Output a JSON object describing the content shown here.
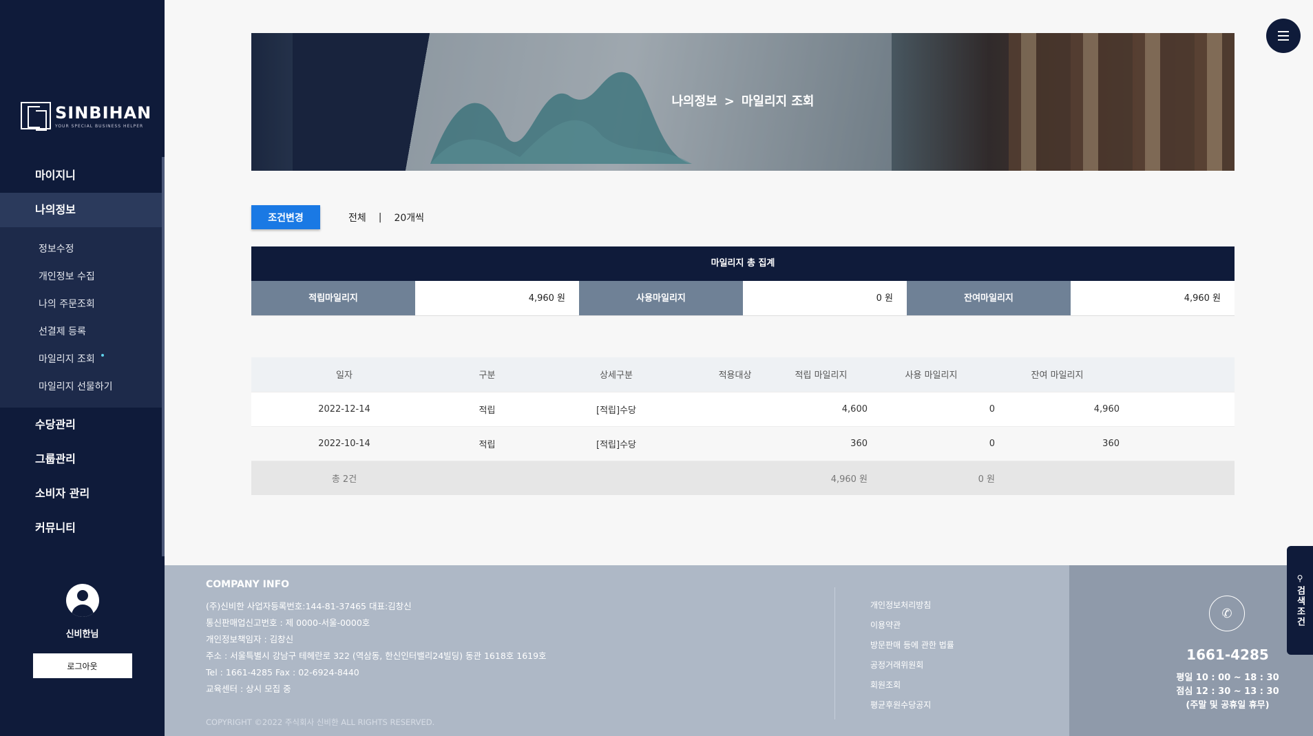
{
  "sidebar": {
    "logo": {
      "name": "SINBIHAN",
      "tagline": "YOUR SPECIAL BUSINESS HELPER"
    },
    "menu": [
      {
        "label": "마이지니"
      },
      {
        "label": "나의정보",
        "active": true
      }
    ],
    "submenu": [
      {
        "label": "정보수정"
      },
      {
        "label": "개인정보 수집"
      },
      {
        "label": "나의 주문조회"
      },
      {
        "label": "선결제 등록"
      },
      {
        "label": "마일리지 조회",
        "active": true
      },
      {
        "label": "마일리지 선물하기"
      }
    ],
    "menu_bottom": [
      {
        "label": "수당관리"
      },
      {
        "label": "그룹관리"
      },
      {
        "label": "소비자 관리"
      },
      {
        "label": "커뮤니티"
      }
    ],
    "user_name": "신비한님",
    "logout_label": "로그아웃"
  },
  "banner": {
    "crumb_parent": "나의정보",
    "crumb_sep": ">",
    "crumb_current": "마일리지 조회"
  },
  "filter": {
    "button_label": "조건변경",
    "scope": "전체",
    "separator": "|",
    "page_size": "20개씩"
  },
  "summary": {
    "title": "마일리지 총 집계",
    "earned_label": "적립마일리지",
    "earned_value": "4,960 원",
    "used_label": "사용마일리지",
    "used_value": "0 원",
    "balance_label": "잔여마일리지",
    "balance_value": "4,960 원"
  },
  "table": {
    "headers": [
      "일자",
      "구분",
      "상세구분",
      "적용대상",
      "적립 마일리지",
      "사용 마일리지",
      "잔여 마일리지"
    ],
    "rows": [
      {
        "date": "2022-12-14",
        "type": "적립",
        "detail": "[적립]수당",
        "target": "",
        "earned": "4,600",
        "used": "0",
        "balance": "4,960"
      },
      {
        "date": "2022-10-14",
        "type": "적립",
        "detail": "[적립]수당",
        "target": "",
        "earned": "360",
        "used": "0",
        "balance": "360"
      }
    ],
    "total": {
      "count": "총 2건",
      "earned": "4,960 원",
      "used": "0 원"
    }
  },
  "footer": {
    "title": "COMPANY INFO",
    "lines": [
      "(주)신비한    사업자등록번호:144-81-37465    대표:김창신",
      "통신판매업신고번호 : 제 0000-서울-0000호",
      "개인정보책임자 : 김창신",
      "주소 : 서울특별시 강남구 테헤란로 322 (역삼동, 한신인터밸리24빌딩) 동관 1618호 1619호",
      "Tel : 1661-4285    Fax : 02-6924-8440",
      "교육센터 : 상시 모집 중"
    ],
    "copyright": "COPYRIGHT ©2022 주식회사 신비한 ALL RIGHTS RESERVED.",
    "links": [
      "개인정보처리방침",
      "이용약관",
      "방문판매 등에 관한 법률",
      "공정거래위원회",
      "회원조회",
      "평균후원수당공지"
    ]
  },
  "contact": {
    "phone": "1661-4285",
    "hours1": "평일 10 : 00 ~ 18 : 30",
    "hours2": "점심 12 : 30 ~ 13 : 30",
    "hours3": "(주말 및 공휴일 휴무)"
  },
  "search_tab": {
    "label": "검색조건"
  },
  "colors": {
    "navy": "#0f1b3a",
    "accent_blue": "#1a79e4",
    "summary_label": "#6f8196",
    "footer_bg": "#aeb8c6",
    "contact_bg": "#8f9aaa"
  }
}
